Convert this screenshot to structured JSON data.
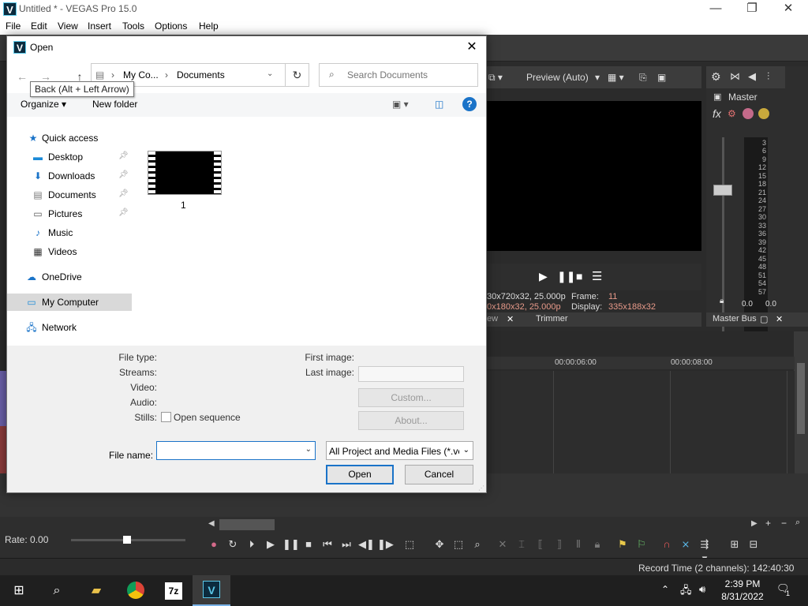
{
  "vegas": {
    "title": "Untitled * - VEGAS Pro 15.0",
    "app_letter": "V",
    "window_controls": {
      "minimize": "—",
      "maximize": "❐",
      "close": "✕"
    },
    "menu": [
      "File",
      "Edit",
      "View",
      "Insert",
      "Tools",
      "Options",
      "Help"
    ],
    "preview": {
      "mode": "Preview (Auto)",
      "info_project": "30x720x32, 25.000p",
      "info_preview": "0x180x32, 25.000p",
      "frame_label": "Frame:",
      "frame_value": "11",
      "display_label": "Display:",
      "display_value": "335x188x32",
      "tab_fragment": "ew",
      "tab_trimmer": "Trimmer"
    },
    "master": {
      "label": "Master",
      "fx_label": "fx",
      "meter_scale": [
        "3",
        "6",
        "9",
        "12",
        "15",
        "18",
        "21",
        "24",
        "27",
        "30",
        "33",
        "36",
        "39",
        "42",
        "45",
        "48",
        "51",
        "54",
        "57"
      ],
      "meter_left": "0.0",
      "meter_right": "0.0",
      "bus_label": "Master Bus"
    },
    "timeline": {
      "ruler": [
        "00:00:06:00",
        "00:00:08:00"
      ]
    },
    "transport": {
      "rate": "Rate: 0.00"
    },
    "status": {
      "record_time": "Record Time (2 channels): 142:40:30"
    }
  },
  "taskbar": {
    "time": "2:39 PM",
    "date": "8/31/2022",
    "seven_zip": "7z",
    "notification_count": "1"
  },
  "dialog": {
    "title": "Open",
    "app_letter": "V",
    "close": "✕",
    "nav": {
      "back": "←",
      "forward": "→",
      "up": "↑"
    },
    "tooltip": "Back (Alt + Left Arrow)",
    "breadcrumb": [
      "My Co...",
      "Documents"
    ],
    "breadcrumb_sep": "›",
    "refresh": "↻",
    "search_placeholder": "Search Documents",
    "organize": "Organize ▾",
    "new_folder": "New folder",
    "help": "?",
    "nav_items": [
      {
        "label": "Quick access",
        "icon": "star-icon"
      },
      {
        "label": "Desktop",
        "icon": "desktop-icon"
      },
      {
        "label": "Downloads",
        "icon": "download-icon"
      },
      {
        "label": "Documents",
        "icon": "document-icon"
      },
      {
        "label": "Pictures",
        "icon": "picture-icon"
      },
      {
        "label": "Music",
        "icon": "music-icon"
      },
      {
        "label": "Videos",
        "icon": "video-icon"
      },
      {
        "label": "OneDrive",
        "icon": "cloud-icon"
      },
      {
        "label": "My Computer",
        "icon": "computer-icon"
      },
      {
        "label": "Network",
        "icon": "network-icon"
      }
    ],
    "file": {
      "name": "1"
    },
    "props": {
      "file_type": "File type:",
      "streams": "Streams:",
      "video": "Video:",
      "audio": "Audio:",
      "stills": "Stills:",
      "open_sequence": "Open sequence",
      "first_image": "First image:",
      "last_image": "Last image:",
      "custom_btn": "Custom...",
      "about_btn": "About..."
    },
    "file_name_label": "File name:",
    "file_name_value": "",
    "file_type_value": "All Project and Media Files (*.ve",
    "open_btn": "Open",
    "cancel_btn": "Cancel"
  }
}
